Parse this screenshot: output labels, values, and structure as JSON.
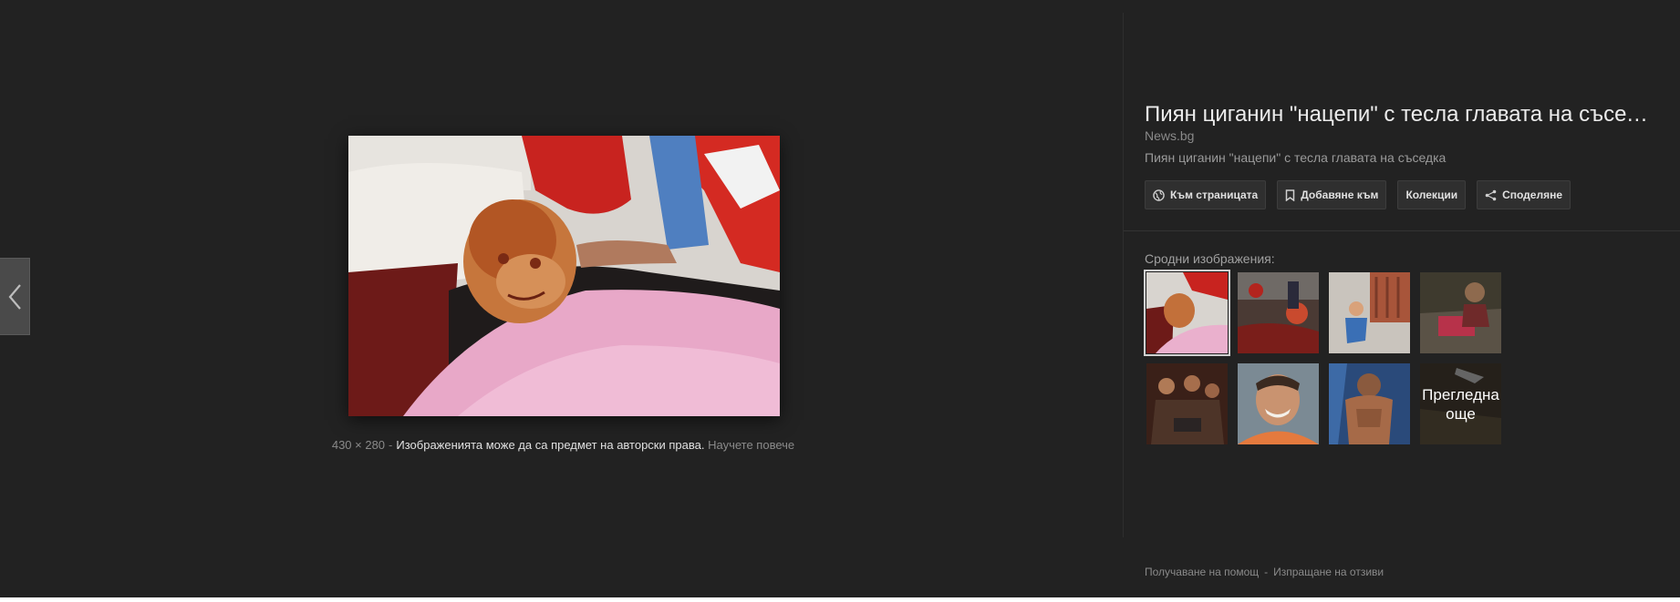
{
  "navigation": {
    "prev_icon": "chevron-left-icon"
  },
  "image": {
    "dimensions": "430 × 280",
    "separator": "-",
    "copyright_notice": "Изображенията може да са предмет на авторски права.",
    "learn_more": "Научете повече"
  },
  "side_panel": {
    "title": "Пиян циганин \"нацепи\" с тесла главата на съседка",
    "source": "News.bg",
    "description": "Пиян циганин \"нацепи\" с тесла главата на съседка",
    "actions": [
      {
        "label": "Към страницата",
        "icon": "globe-icon"
      },
      {
        "label": "Добавяне към",
        "icon": "bookmark-icon"
      },
      {
        "label": "Колекции",
        "icon": ""
      },
      {
        "label": "Споделяне",
        "icon": "share-icon"
      }
    ],
    "related_label": "Сродни изображения:",
    "view_more_label": "Прегледна още"
  },
  "footer": {
    "help": "Получаване на помощ",
    "separator": "-",
    "feedback": "Изпращане на отзиви"
  },
  "colors": {
    "background": "#222222",
    "button_bg": "#2f2f2f",
    "title_text": "#ececec",
    "muted_text": "#8a8a8a"
  }
}
